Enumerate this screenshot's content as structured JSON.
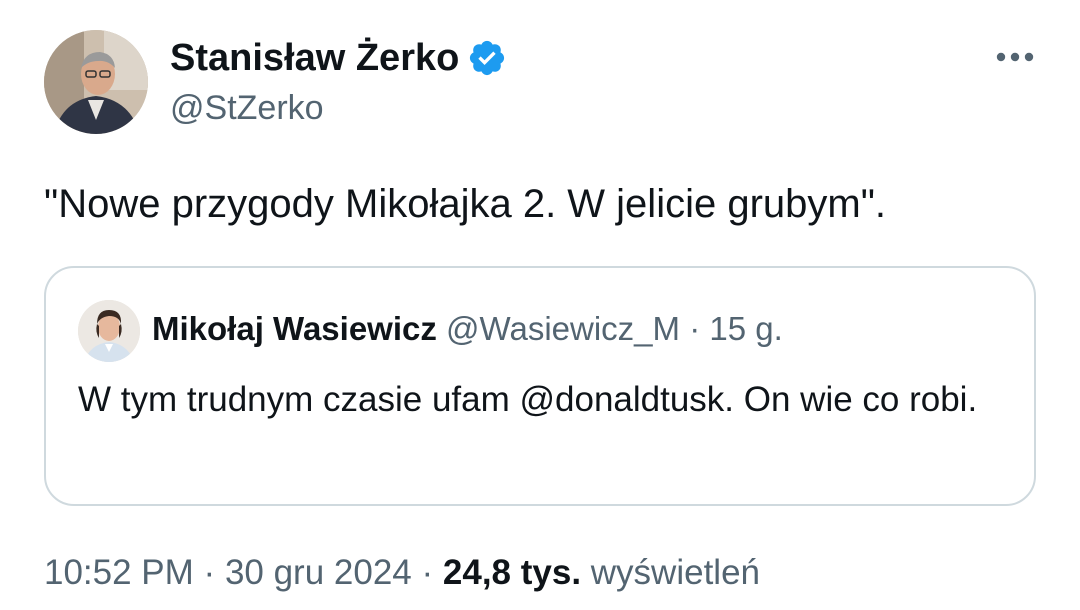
{
  "author": {
    "name": "Stanisław Żerko",
    "handle": "@StZerko",
    "verified": true,
    "verified_icon": "verified-badge-icon",
    "verified_color": "#1d9bf0"
  },
  "more_icon": "more-horizontal-icon",
  "tweet": {
    "text": "\"Nowe przygody Mikołajka 2. W jelicie grubym\"."
  },
  "quote": {
    "name": "Mikołaj Wasiewicz",
    "handle": "@Wasiewicz_M",
    "separator": "·",
    "age": "15 g.",
    "text": "W tym trudnym czasie ufam @donaldtusk. On wie co robi."
  },
  "footer": {
    "time": "10:52 PM",
    "sep1": "·",
    "date": "30 gru 2024",
    "sep2": "·",
    "views_count": "24,8 tys.",
    "views_label": "wyświetleń"
  },
  "colors": {
    "text_primary": "#0f1419",
    "text_secondary": "#536471",
    "border": "#cfd9de",
    "accent": "#1d9bf0"
  }
}
